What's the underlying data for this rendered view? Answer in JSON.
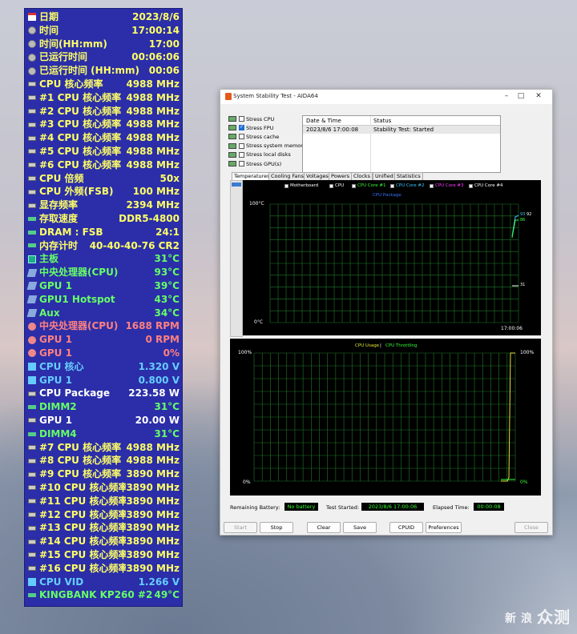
{
  "osd": {
    "rows": [
      {
        "label": "日期",
        "value": "2023/8/6",
        "color": "#ffff66",
        "icon": "calendar-icon"
      },
      {
        "label": "时间",
        "value": "17:00:14",
        "color": "#ffff66",
        "icon": "clock-icon"
      },
      {
        "label": "时间(HH:mm)",
        "value": "17:00",
        "color": "#ffff66",
        "icon": "clock-icon"
      },
      {
        "label": "已运行时间",
        "value": "00:06:06",
        "color": "#ffff66",
        "icon": "clock-icon"
      },
      {
        "label": "已运行时间 (HH:mm)",
        "value": "00:06",
        "color": "#ffff66",
        "icon": "clock-icon"
      },
      {
        "label": "CPU 核心频率",
        "value": "4988 MHz",
        "color": "#ffff66",
        "icon": "chip-icon"
      },
      {
        "label": "#1 CPU 核心频率",
        "value": "4988 MHz",
        "color": "#ffff66",
        "icon": "chip-icon"
      },
      {
        "label": "#2 CPU 核心频率",
        "value": "4988 MHz",
        "color": "#ffff66",
        "icon": "chip-icon"
      },
      {
        "label": "#3 CPU 核心频率",
        "value": "4988 MHz",
        "color": "#ffff66",
        "icon": "chip-icon"
      },
      {
        "label": "#4 CPU 核心频率",
        "value": "4988 MHz",
        "color": "#ffff66",
        "icon": "chip-icon"
      },
      {
        "label": "#5 CPU 核心频率",
        "value": "4988 MHz",
        "color": "#ffff66",
        "icon": "chip-icon"
      },
      {
        "label": "#6 CPU 核心频率",
        "value": "4988 MHz",
        "color": "#ffff66",
        "icon": "chip-icon"
      },
      {
        "label": "CPU 倍频",
        "value": "50x",
        "color": "#ffff66",
        "icon": "chip-icon"
      },
      {
        "label": "CPU 外频(FSB)",
        "value": "100 MHz",
        "color": "#ffff66",
        "icon": "chip-icon"
      },
      {
        "label": "显存频率",
        "value": "2394 MHz",
        "color": "#ffff66",
        "icon": "chip-icon"
      },
      {
        "label": "存取速度",
        "value": "DDR5-4800",
        "color": "#ffff66",
        "icon": "memory-icon"
      },
      {
        "label": "DRAM : FSB",
        "value": "24:1",
        "color": "#ffff66",
        "icon": "memory-icon"
      },
      {
        "label": "内存计时",
        "value": "40-40-40-76 CR2",
        "color": "#ffff66",
        "icon": "memory-icon"
      },
      {
        "label": "主板",
        "value": "31°C",
        "color": "#66ff66",
        "icon": "motherboard-icon"
      },
      {
        "label": "中央处理器(CPU)",
        "value": "93°C",
        "color": "#66ff66",
        "icon": "cpu-temp-icon"
      },
      {
        "label": "GPU 1",
        "value": "39°C",
        "color": "#66ff66",
        "icon": "gpu-icon"
      },
      {
        "label": "GPU1 Hotspot",
        "value": "43°C",
        "color": "#66ff66",
        "icon": "gpu-icon"
      },
      {
        "label": "Aux",
        "value": "34°C",
        "color": "#66ff66",
        "icon": "gpu-icon"
      },
      {
        "label": "中央处理器(CPU)",
        "value": "1688 RPM",
        "color": "#ff8080",
        "icon": "fan-icon"
      },
      {
        "label": "GPU 1",
        "value": "0 RPM",
        "color": "#ff8080",
        "icon": "fan-icon"
      },
      {
        "label": "GPU 1",
        "value": "0%",
        "color": "#ff8080",
        "icon": "fan-icon"
      },
      {
        "label": "CPU 核心",
        "value": "1.320 V",
        "color": "#66ccff",
        "icon": "voltage-icon"
      },
      {
        "label": "GPU 1",
        "value": "0.800 V",
        "color": "#66ccff",
        "icon": "voltage-icon"
      },
      {
        "label": "CPU Package",
        "value": "223.58 W",
        "color": "#ffffff",
        "icon": "power-icon"
      },
      {
        "label": "DIMM2",
        "value": "31°C",
        "color": "#66ff66",
        "icon": "memory-icon"
      },
      {
        "label": "GPU 1",
        "value": "20.00 W",
        "color": "#ffffff",
        "icon": "power-icon"
      },
      {
        "label": "DIMM4",
        "value": "31°C",
        "color": "#66ff66",
        "icon": "memory-icon"
      },
      {
        "label": "#7 CPU 核心频率",
        "value": "4988 MHz",
        "color": "#ffff66",
        "icon": "chip-icon"
      },
      {
        "label": "#8 CPU 核心频率",
        "value": "4988 MHz",
        "color": "#ffff66",
        "icon": "chip-icon"
      },
      {
        "label": "#9 CPU 核心频率",
        "value": "3890 MHz",
        "color": "#ffff66",
        "icon": "chip-icon"
      },
      {
        "label": "#10 CPU 核心频率",
        "value": "3890 MHz",
        "color": "#ffff66",
        "icon": "chip-icon"
      },
      {
        "label": "#11 CPU 核心频率",
        "value": "3890 MHz",
        "color": "#ffff66",
        "icon": "chip-icon"
      },
      {
        "label": "#12 CPU 核心频率",
        "value": "3890 MHz",
        "color": "#ffff66",
        "icon": "chip-icon"
      },
      {
        "label": "#13 CPU 核心频率",
        "value": "3890 MHz",
        "color": "#ffff66",
        "icon": "chip-icon"
      },
      {
        "label": "#14 CPU 核心频率",
        "value": "3890 MHz",
        "color": "#ffff66",
        "icon": "chip-icon"
      },
      {
        "label": "#15 CPU 核心频率",
        "value": "3890 MHz",
        "color": "#ffff66",
        "icon": "chip-icon"
      },
      {
        "label": "#16 CPU 核心频率",
        "value": "3890 MHz",
        "color": "#ffff66",
        "icon": "chip-icon"
      },
      {
        "label": "CPU VID",
        "value": "1.266 V",
        "color": "#66ccff",
        "icon": "voltage-icon"
      },
      {
        "label": "KINGBANK KP260 #2",
        "value": "49°C",
        "color": "#66ff66",
        "icon": "drive-icon"
      }
    ]
  },
  "window": {
    "title": "System Stability Test - AIDA64",
    "stress": [
      {
        "label": "Stress CPU",
        "checked": false
      },
      {
        "label": "Stress FPU",
        "checked": true
      },
      {
        "label": "Stress cache",
        "checked": false
      },
      {
        "label": "Stress system memory",
        "checked": false
      },
      {
        "label": "Stress local disks",
        "checked": false
      },
      {
        "label": "Stress GPU(s)",
        "checked": false
      }
    ],
    "status_table": {
      "col_date": "Date & Time",
      "col_status": "Status",
      "row_date": "2023/8/6 17:00:08",
      "row_status": "Stability Test: Started"
    },
    "tabs": [
      "Temperatures",
      "Cooling Fans",
      "Voltages",
      "Powers",
      "Clocks",
      "Unified",
      "Statistics"
    ],
    "temp_graph": {
      "legend": [
        {
          "label": "Motherboard",
          "color": "#ffffff"
        },
        {
          "label": "CPU",
          "color": "#ffffff"
        },
        {
          "label": "CPU Core #1",
          "color": "#39ff39"
        },
        {
          "label": "CPU Core #2",
          "color": "#39c6ff"
        },
        {
          "label": "CPU Core #3",
          "color": "#ff39ff"
        },
        {
          "label": "CPU Core #4",
          "color": "#ffffff"
        },
        {
          "label": "CPU Package",
          "color": "#3971ff"
        }
      ],
      "ymax_label": "100°C",
      "ymin_label": "0°C",
      "time_label": "17:00:06",
      "right_values": [
        "93",
        "92",
        "86"
      ],
      "right_low": "31"
    },
    "usage_graph": {
      "title_usage": "CPU Usage",
      "sep": "|",
      "title_throttle": "CPU Throttling",
      "ymax_label": "100%",
      "ymin_label": "0%",
      "right_max": "100%",
      "right_min": "0%"
    },
    "footer": {
      "battery_label": "Remaining Battery:",
      "battery_value": "No battery",
      "started_label": "Test Started:",
      "started_value": "2023/8/6 17:00:06",
      "elapsed_label": "Elapsed Time:",
      "elapsed_value": "00:00:08"
    },
    "buttons": {
      "start": "Start",
      "stop": "Stop",
      "clear": "Clear",
      "save": "Save",
      "cpuid": "CPUID",
      "preferences": "Preferences",
      "close": "Close"
    }
  },
  "watermark": {
    "small1": "新",
    "small2": "浪",
    "big": "众测"
  }
}
